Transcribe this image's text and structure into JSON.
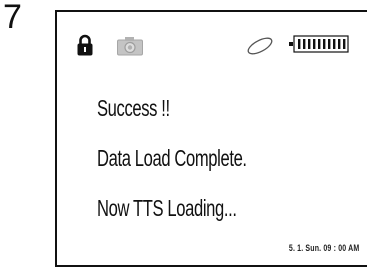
{
  "step": {
    "number": "7"
  },
  "screen": {
    "status_icons": [
      "lock-icon",
      "camera-icon",
      "link-icon",
      "battery-icon"
    ],
    "messages": [
      "Success !!",
      "Data Load Complete.",
      "Now TTS Loading..."
    ],
    "timestamp": "5. 1. Sun. 09 : 00 AM"
  },
  "colors": {
    "text": "#111111",
    "camera_icon": "#b5b5b5",
    "link_icon": "#555555"
  }
}
